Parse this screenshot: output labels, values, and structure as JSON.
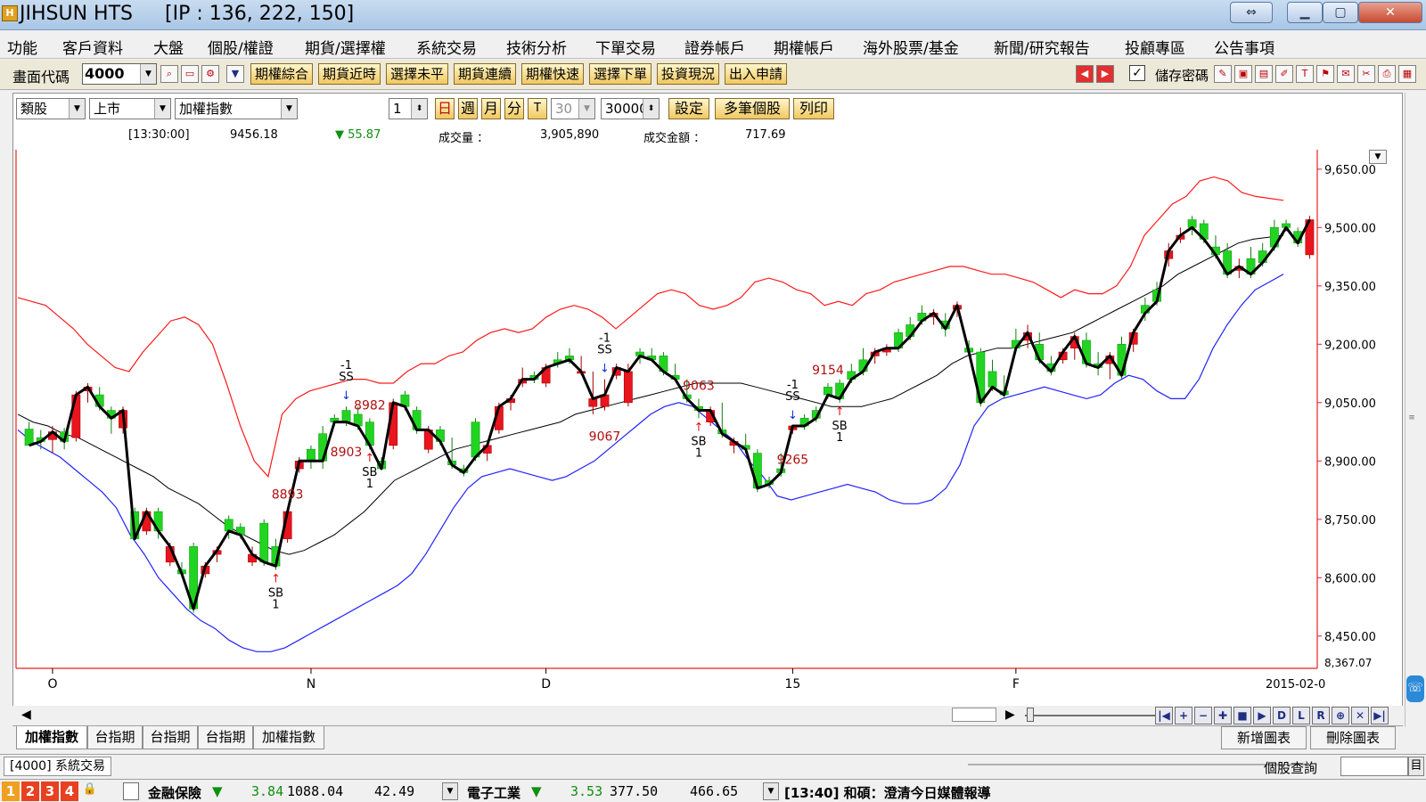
{
  "window": {
    "app_title": "JIHSUN HTS",
    "ip_text": "[IP : 136, 222, 150]",
    "icon_char": "H"
  },
  "menu": [
    "功能",
    "客戶資料",
    "大盤",
    "個股/權證",
    "期貨/選擇權",
    "系統交易",
    "技術分析",
    "下單交易",
    "證券帳戶",
    "期權帳戶",
    "海外股票/基金",
    "新聞/研究報告",
    "投顧專區",
    "公告事項"
  ],
  "toolbar": {
    "code_label": "畫面代碼",
    "code_value": "4000",
    "buttons": [
      "期權綜合",
      "期貨近時",
      "選擇未平",
      "期貨連續",
      "期權快速",
      "選擇下單",
      "投資現況",
      "出入申請"
    ],
    "save_pwd_label": "儲存密碼"
  },
  "controls": {
    "category": "類股",
    "market": "上市",
    "index": "加權指數",
    "count_value": "1",
    "periods": [
      "日",
      "週",
      "月",
      "分",
      "T"
    ],
    "minutes_value": "30",
    "bars_value": "30000",
    "settings_label": "設定",
    "multi_label": "多筆個股",
    "print_label": "列印"
  },
  "quote": {
    "time": "[13:30:00]",
    "price": "9456.18",
    "change": "▼ 55.87",
    "volume_label": "成交量 ：",
    "volume": "3,905,890",
    "amount_label": "成交金額 ：",
    "amount": "717.69"
  },
  "chart_data": {
    "type": "candlestick",
    "y_ticks": [
      "9,650.00",
      "9,500.00",
      "9,350.00",
      "9,200.00",
      "9,050.00",
      "8,900.00",
      "8,750.00",
      "8,600.00",
      "8,450.00"
    ],
    "y_tick_values": [
      9650,
      9500,
      9350,
      9200,
      9050,
      8900,
      8750,
      8600,
      8450
    ],
    "y_bottom_label": "8,367.07",
    "ylim": [
      8367.07,
      9700
    ],
    "x_labels": [
      {
        "bar": 2,
        "text": "O"
      },
      {
        "bar": 24,
        "text": "N"
      },
      {
        "bar": 44,
        "text": "D"
      },
      {
        "bar": 65,
        "text": "15"
      },
      {
        "bar": 84,
        "text": "F"
      }
    ],
    "x_date_label": "2015-02-0",
    "candles": [
      [
        8982,
        9000,
        8940,
        8940
      ],
      [
        8960,
        8980,
        8930,
        8950
      ],
      [
        8955,
        8990,
        8920,
        8975
      ],
      [
        8975,
        8985,
        8930,
        8950
      ],
      [
        8960,
        9080,
        8950,
        9070
      ],
      [
        9080,
        9100,
        9050,
        9090
      ],
      [
        9070,
        9090,
        9030,
        9040
      ],
      [
        9030,
        9040,
        8970,
        9010
      ],
      [
        8985,
        9040,
        8970,
        9030
      ],
      [
        8770,
        8780,
        8710,
        8700
      ],
      [
        8720,
        8780,
        8710,
        8770
      ],
      [
        8770,
        8780,
        8700,
        8720
      ],
      [
        8640,
        8690,
        8630,
        8680
      ],
      [
        8620,
        8640,
        8600,
        8610
      ],
      [
        8680,
        8690,
        8510,
        8520
      ],
      [
        8610,
        8640,
        8600,
        8630
      ],
      [
        8660,
        8680,
        8640,
        8670
      ],
      [
        8750,
        8760,
        8700,
        8720
      ],
      [
        8730,
        8740,
        8700,
        8710
      ],
      [
        8640,
        8680,
        8630,
        8660
      ],
      [
        8740,
        8750,
        8630,
        8640
      ],
      [
        8680,
        8700,
        8620,
        8630
      ],
      [
        8700,
        8780,
        8690,
        8770
      ],
      [
        8880,
        8910,
        8870,
        8900
      ],
      [
        8930,
        8940,
        8880,
        8900
      ],
      [
        8970,
        8990,
        8880,
        8900
      ],
      [
        9010,
        9020,
        8990,
        9000
      ],
      [
        9030,
        9040,
        8990,
        9000
      ],
      [
        9020,
        9040,
        8980,
        8990
      ],
      [
        9000,
        9010,
        8930,
        8940
      ],
      [
        8900,
        8910,
        8890,
        8880
      ],
      [
        8940,
        9060,
        8930,
        9050
      ],
      [
        9070,
        9080,
        9030,
        9040
      ],
      [
        9030,
        9040,
        8970,
        8980
      ],
      [
        8930,
        8990,
        8920,
        8980
      ],
      [
        8980,
        8990,
        8940,
        8950
      ],
      [
        8900,
        8960,
        8880,
        8890
      ],
      [
        8880,
        8890,
        8860,
        8870
      ],
      [
        9000,
        9010,
        8900,
        8910
      ],
      [
        8920,
        8940,
        8900,
        8940
      ],
      [
        8980,
        9050,
        8970,
        9040
      ],
      [
        9050,
        9070,
        9030,
        9060
      ],
      [
        9100,
        9140,
        9090,
        9110
      ],
      [
        9120,
        9130,
        9100,
        9110
      ],
      [
        9100,
        9150,
        9090,
        9140
      ],
      [
        9160,
        9180,
        9140,
        9150
      ],
      [
        9170,
        9190,
        9150,
        9160
      ],
      [
        9130,
        9170,
        9120,
        9130
      ],
      [
        9040,
        9130,
        9020,
        9060
      ],
      [
        9040,
        9110,
        9030,
        9070
      ],
      [
        9120,
        9150,
        9110,
        9140
      ],
      [
        9050,
        9150,
        9040,
        9130
      ],
      [
        9180,
        9190,
        9150,
        9170
      ],
      [
        9170,
        9190,
        9160,
        9160
      ],
      [
        9170,
        9180,
        9120,
        9130
      ],
      [
        9120,
        9150,
        9110,
        9110
      ],
      [
        9070,
        9110,
        9050,
        9060
      ],
      [
        9040,
        9060,
        9010,
        9030
      ],
      [
        9000,
        9040,
        8990,
        9030
      ],
      [
        8980,
        9050,
        8960,
        8970
      ],
      [
        8940,
        8960,
        8920,
        8950
      ],
      [
        8940,
        8970,
        8920,
        8930
      ],
      [
        8920,
        8930,
        8820,
        8830
      ],
      [
        8850,
        8860,
        8830,
        8840
      ],
      [
        8880,
        8920,
        8860,
        8870
      ],
      [
        8980,
        8990,
        8970,
        8990
      ],
      [
        9010,
        9020,
        8980,
        8990
      ],
      [
        9030,
        9040,
        9000,
        9010
      ],
      [
        9090,
        9100,
        9060,
        9070
      ],
      [
        9100,
        9110,
        9050,
        9060
      ],
      [
        9130,
        9150,
        9100,
        9110
      ],
      [
        9160,
        9190,
        9120,
        9130
      ],
      [
        9170,
        9190,
        9150,
        9180
      ],
      [
        9180,
        9200,
        9170,
        9190
      ],
      [
        9230,
        9240,
        9180,
        9190
      ],
      [
        9250,
        9270,
        9210,
        9220
      ],
      [
        9280,
        9300,
        9250,
        9260
      ],
      [
        9270,
        9290,
        9250,
        9280
      ],
      [
        9260,
        9280,
        9220,
        9240
      ],
      [
        9290,
        9310,
        9270,
        9300
      ],
      [
        9190,
        9210,
        9170,
        9180
      ],
      [
        9180,
        9190,
        9040,
        9050
      ],
      [
        9130,
        9160,
        9080,
        9090
      ],
      [
        9080,
        9120,
        9060,
        9070
      ],
      [
        9210,
        9240,
        9180,
        9190
      ],
      [
        9210,
        9250,
        9190,
        9230
      ],
      [
        9200,
        9230,
        9150,
        9160
      ],
      [
        9150,
        9170,
        9120,
        9130
      ],
      [
        9160,
        9190,
        9150,
        9180
      ],
      [
        9190,
        9230,
        9160,
        9220
      ],
      [
        9210,
        9230,
        9140,
        9150
      ],
      [
        9150,
        9180,
        9120,
        9140
      ],
      [
        9150,
        9180,
        9110,
        9170
      ],
      [
        9200,
        9220,
        9110,
        9120
      ],
      [
        9200,
        9240,
        9180,
        9230
      ],
      [
        9300,
        9320,
        9260,
        9280
      ],
      [
        9340,
        9360,
        9300,
        9310
      ],
      [
        9420,
        9460,
        9400,
        9440
      ],
      [
        9470,
        9500,
        9460,
        9480
      ],
      [
        9520,
        9530,
        9480,
        9500
      ],
      [
        9510,
        9520,
        9460,
        9470
      ],
      [
        9450,
        9480,
        9420,
        9430
      ],
      [
        9440,
        9460,
        9370,
        9380
      ],
      [
        9390,
        9420,
        9370,
        9400
      ],
      [
        9420,
        9450,
        9370,
        9380
      ],
      [
        9440,
        9460,
        9400,
        9410
      ],
      [
        9500,
        9520,
        9440,
        9450
      ],
      [
        9510,
        9520,
        9490,
        9500
      ],
      [
        9490,
        9500,
        9450,
        9460
      ],
      [
        9430,
        9530,
        9420,
        9520
      ]
    ],
    "bollinger": {
      "upper": [
        9320,
        9310,
        9300,
        9270,
        9240,
        9200,
        9170,
        9140,
        9130,
        9180,
        9220,
        9260,
        9270,
        9250,
        9200,
        9100,
        8990,
        8900,
        8860,
        9020,
        9060,
        9080,
        9090,
        9100,
        9110,
        9110,
        9100,
        9100,
        9130,
        9150,
        9150,
        9170,
        9180,
        9210,
        9230,
        9240,
        9230,
        9240,
        9270,
        9290,
        9300,
        9290,
        9270,
        9240,
        9270,
        9300,
        9330,
        9340,
        9330,
        9300,
        9290,
        9300,
        9320,
        9360,
        9370,
        9360,
        9340,
        9330,
        9300,
        9310,
        9300,
        9330,
        9340,
        9360,
        9370,
        9380,
        9390,
        9400,
        9400,
        9390,
        9380,
        9380,
        9370,
        9360,
        9340,
        9320,
        9340,
        9330,
        9330,
        9350,
        9400,
        9480,
        9520,
        9560,
        9580,
        9620,
        9630,
        9620,
        9590,
        9580,
        9575,
        9570
      ],
      "mid": [
        9020,
        9000,
        8990,
        8970,
        8960,
        8940,
        8920,
        8900,
        8880,
        8860,
        8830,
        8810,
        8790,
        8760,
        8730,
        8710,
        8690,
        8670,
        8660,
        8670,
        8690,
        8710,
        8740,
        8770,
        8810,
        8850,
        8870,
        8890,
        8910,
        8930,
        8940,
        8950,
        8960,
        8970,
        8980,
        8990,
        9000,
        9020,
        9030,
        9040,
        9050,
        9060,
        9070,
        9080,
        9090,
        9100,
        9100,
        9100,
        9100,
        9090,
        9080,
        9070,
        9060,
        9050,
        9040,
        9040,
        9040,
        9050,
        9060,
        9080,
        9100,
        9120,
        9150,
        9170,
        9180,
        9190,
        9190,
        9200,
        9210,
        9220,
        9230,
        9250,
        9270,
        9290,
        9310,
        9330,
        9350,
        9380,
        9400,
        9420,
        9440,
        9460,
        9470,
        9475,
        9480
      ],
      "lower": [
        8980,
        8950,
        8930,
        8910,
        8880,
        8850,
        8820,
        8780,
        8710,
        8660,
        8600,
        8560,
        8520,
        8490,
        8470,
        8440,
        8420,
        8410,
        8410,
        8420,
        8440,
        8460,
        8480,
        8500,
        8520,
        8540,
        8560,
        8580,
        8610,
        8660,
        8720,
        8780,
        8830,
        8860,
        8870,
        8880,
        8870,
        8860,
        8850,
        8860,
        8880,
        8900,
        8930,
        8960,
        8990,
        9020,
        9040,
        9050,
        9040,
        9010,
        8980,
        8950,
        8900,
        8860,
        8810,
        8800,
        8810,
        8820,
        8830,
        8840,
        8830,
        8820,
        8800,
        8790,
        8790,
        8800,
        8830,
        8890,
        8990,
        9040,
        9060,
        9070,
        9080,
        9090,
        9080,
        9070,
        9060,
        9070,
        9100,
        9120,
        9110,
        9080,
        9060,
        9060,
        9110,
        9190,
        9250,
        9300,
        9340,
        9360,
        9380
      ]
    },
    "signals": [
      {
        "bar": 21,
        "type": "SB",
        "label": "SB\n1",
        "price_label": "8893",
        "price_label_bar": 22
      },
      {
        "bar": 27,
        "type": "SS",
        "label": "-1\nSS",
        "price_label": "8903",
        "price_label_bar": 27
      },
      {
        "bar": 29,
        "type": "SB",
        "label": "SB\n1",
        "price_label": "8982",
        "price_label_bar": 29
      },
      {
        "bar": 49,
        "type": "SS",
        "label": "-1\nSS",
        "price_label": "9067",
        "price_label_bar": 49
      },
      {
        "bar": 57,
        "type": "SB",
        "label": "SB\n1",
        "price_label": "9063",
        "price_label_bar": 57
      },
      {
        "bar": 65,
        "type": "SS",
        "label": "-1\nSS",
        "price_label": "9265",
        "price_label_bar": 65
      },
      {
        "bar": 69,
        "type": "SB",
        "label": "SB\n1",
        "price_label": "9154",
        "price_label_bar": 68
      }
    ]
  },
  "bottom": {
    "tabs": [
      "加權指數",
      "台指期",
      "台指期",
      "台指期",
      "加權指數"
    ],
    "new_chart": "新增圖表",
    "delete_chart": "刪除圖表",
    "nav_buttons": [
      "|◀",
      "+",
      "−",
      "✚",
      "■",
      "▶",
      "D",
      "L",
      "R",
      "⊕",
      "✕",
      "▶|"
    ]
  },
  "status": {
    "path_text": "[4000] 系統交易",
    "stock_query": "個股查詢",
    "query_btn": "目"
  },
  "ticker": {
    "groups": [
      "1",
      "2",
      "3",
      "4"
    ],
    "item1_name": "金融保險",
    "item1_arrow": "▼",
    "item1_change": "3.84",
    "item1_value": "1088.04",
    "item1_vol": "42.49",
    "item2_name": "電子工業",
    "item2_arrow": "▼",
    "item2_change": "3.53",
    "item2_value": "377.50",
    "item2_vol": "466.65",
    "news": "[13:40] 和碩：澄清今日媒體報導"
  },
  "colors": {
    "up": "#e8141e",
    "down": "#22d422",
    "upper_band": "#ff1a1a",
    "lower_band": "#2222ff",
    "mid_band": "#000000",
    "price_label": "#b01010"
  }
}
